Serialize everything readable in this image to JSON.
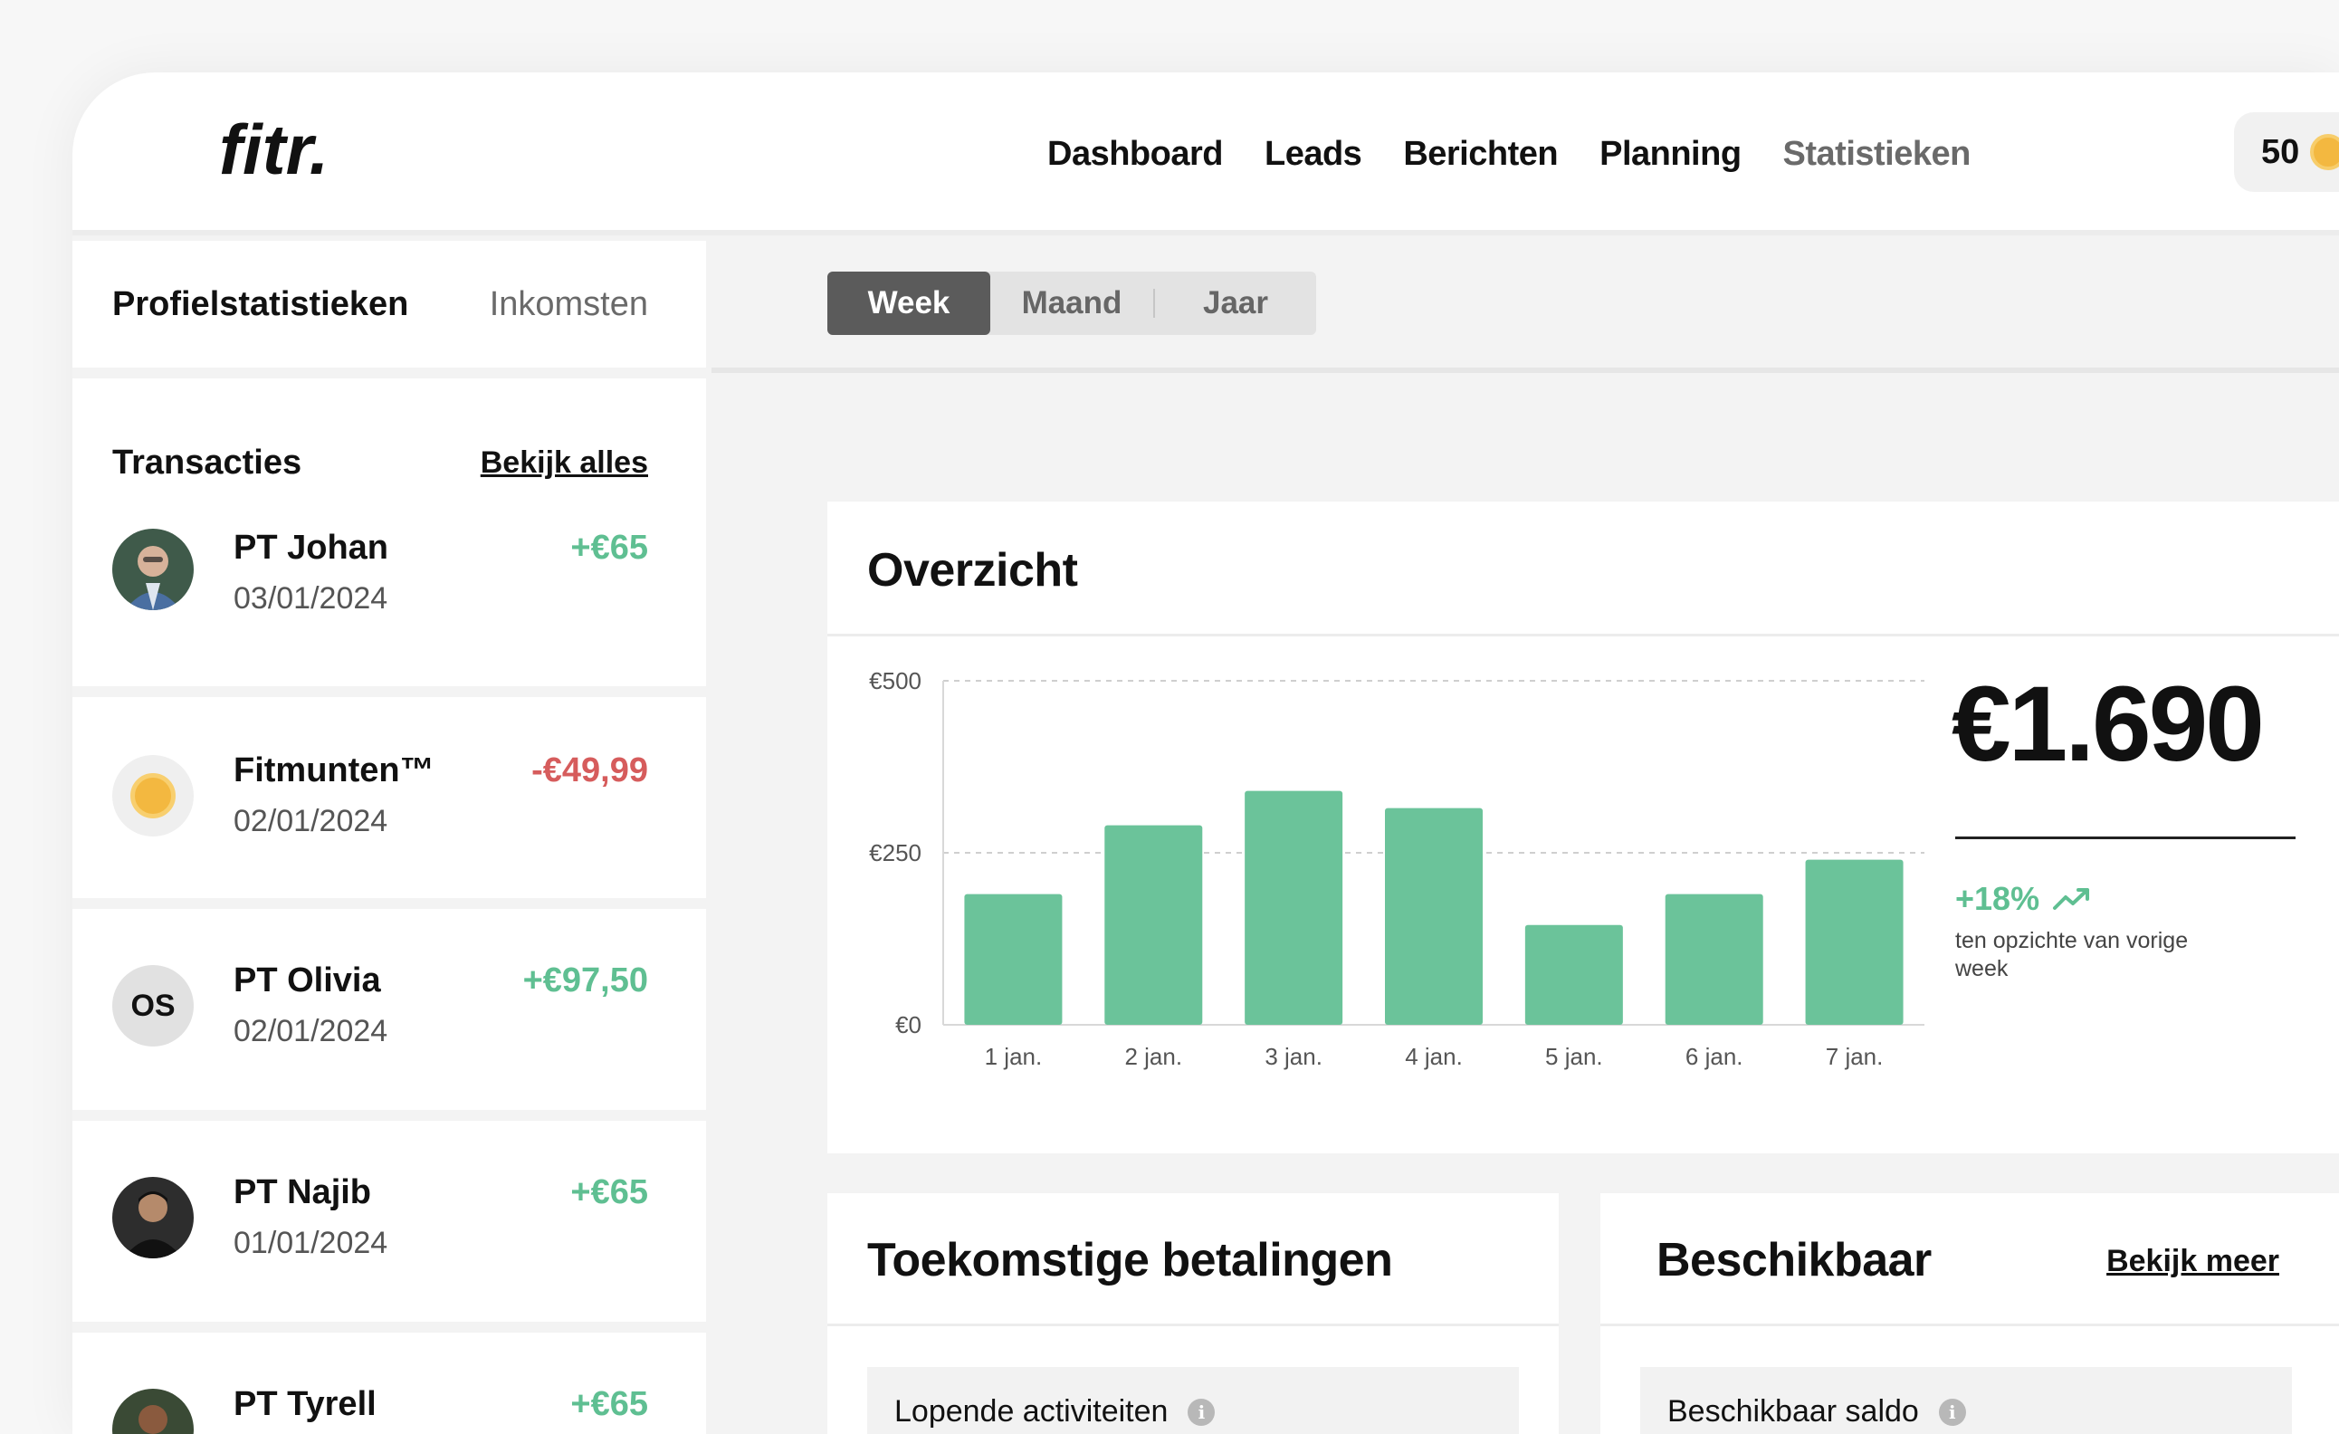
{
  "header": {
    "logo_text": "fitr.",
    "nav": [
      "Dashboard",
      "Leads",
      "Berichten",
      "Planning",
      "Statistieken"
    ],
    "coins": "50",
    "coin_icon": "coin-icon"
  },
  "sidebar": {
    "tabs": [
      "Profielstatistieken",
      "Inkomsten"
    ],
    "transactions_title": "Transacties",
    "transactions_link": "Bekijk alles",
    "transactions": [
      {
        "name": "PT Johan",
        "date": "03/01/2024",
        "amount": "+€65",
        "avatar": "photo"
      },
      {
        "name": "Fitmunten™",
        "date": "02/01/2024",
        "amount": "-€49,99",
        "avatar": "coin"
      },
      {
        "name": "PT Olivia",
        "date": "02/01/2024",
        "amount": "+€97,50",
        "avatar": "OS"
      },
      {
        "name": "PT Najib",
        "date": "01/01/2024",
        "amount": "+€65",
        "avatar": "photo"
      },
      {
        "name": "PT Tyrell",
        "date": "",
        "amount": "+€65",
        "avatar": "photo"
      }
    ]
  },
  "period_tabs": [
    "Week",
    "Maand",
    "Jaar"
  ],
  "overview": {
    "title": "Overzicht",
    "total": "€1.690",
    "change": "+18%",
    "change_icon": "trending-up-icon",
    "change_note": "ten opzichte van vorige week"
  },
  "chart_data": {
    "type": "bar",
    "categories": [
      "1 jan.",
      "2 jan.",
      "3 jan.",
      "4 jan.",
      "5 jan.",
      "6 jan.",
      "7 jan."
    ],
    "values": [
      190,
      290,
      340,
      315,
      145,
      190,
      240
    ],
    "ylim": [
      0,
      500
    ],
    "yticks": [
      "€0",
      "€250",
      "€500"
    ],
    "ytick_values": [
      0,
      250,
      500
    ],
    "grid": true,
    "bar_color": "#6bc39a"
  },
  "upcoming": {
    "title": "Toekomstige betalingen",
    "box_label": "Lopende activiteiten"
  },
  "available": {
    "title": "Beschikbaar",
    "link": "Bekijk meer",
    "box_label": "Beschikbaar saldo"
  },
  "colors": {
    "positive": "#5fbf92",
    "negative": "#d65c5c",
    "accent_bar": "#6bc39a"
  }
}
